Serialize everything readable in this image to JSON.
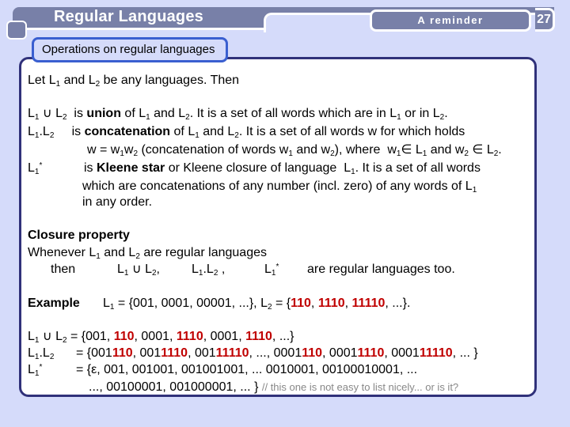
{
  "header": {
    "title": "Regular Languages",
    "section_tag": "A reminder",
    "page_number": "27",
    "subtitle": "Operations on regular languages"
  },
  "intro": "Let L1 and L2 be any languages. Then",
  "definitions": {
    "union": {
      "term": "L1 ∪ L2",
      "text_pre": "is ",
      "keyword": "union",
      "text_post": " of L1 and L2. It is a set of all words which are in L1 or in L2."
    },
    "concat": {
      "term": "L1.L2",
      "text_pre": "is ",
      "keyword": "concatenation",
      "text_post": " of L1 and L2. It is a set of all words w for which holds",
      "line2": "w = w1w2 (concatenation of words w1 and w2), where  w1∈ L1 and w2 ∈ L2."
    },
    "star": {
      "term": "L1*",
      "text_pre": "is ",
      "keyword": "Kleene star",
      "text_post": " or Kleene closure of language  L1. It is a set of all words",
      "line2": "which are concatenations of any number (incl. zero) of any words of L1",
      "line3": "in any order."
    }
  },
  "closure": {
    "heading": "Closure property",
    "line1": "Whenever L1 and L2 are regular languages",
    "then": "then",
    "ops": [
      "L1 ∪ L2,",
      "L1.L2 ,",
      "L1*"
    ],
    "conclusion": "are  regular languages too."
  },
  "example": {
    "label": "Example",
    "l1": "L1 = {001, 0001, 00001, ...},",
    "l2_pre": "L2 = {",
    "l2_items": [
      "110",
      "1110",
      "11110"
    ],
    "l2_post": ", ...}."
  },
  "results": {
    "union_term": "L1 ∪ L2",
    "union_value": "= {001, 110, 0001, 1110, 0001, 1110, ...}",
    "concat_term": "L1.L2",
    "concat_value": "= {001110, 0011110, 00111110, ..., 0001110, 00011110, 000111110, ... }",
    "star_term": "L1*",
    "star_value": "= {ε, 001, 001001, 001001001, ...  0010001, 00100010001, ...",
    "star_value2": "..., 00100001, 001000001, ... }",
    "comment": "// this one is not easy to list nicely... or is it?"
  },
  "colors": {
    "background": "#d5dbfa",
    "header_fill": "#7880a8",
    "panel_border": "#30317a",
    "subtitle_border": "#3a5fd0",
    "highlight": "#c00000"
  }
}
